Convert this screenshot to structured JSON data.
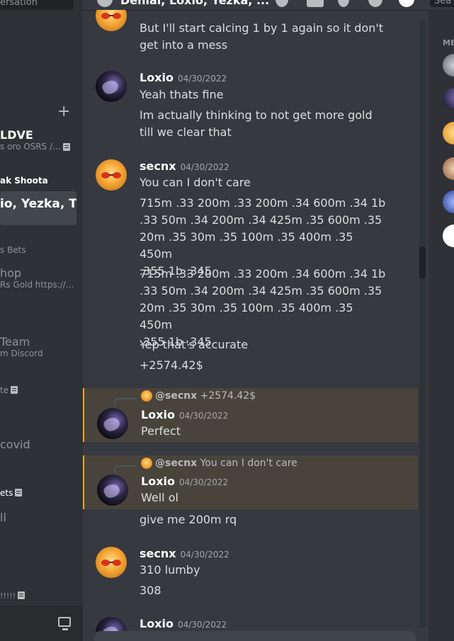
{
  "sidebar": {
    "search_text": "ersation",
    "dms": [
      {
        "name": "LDVE",
        "sub": "s oro OSRS /...",
        "note": true,
        "bold": true
      },
      {
        "name": "ak Shoota",
        "bold": true
      },
      {
        "name": "io, Yezka, T...",
        "bold": true,
        "active": true
      },
      {
        "name": "s Bets"
      },
      {
        "name": "hop",
        "sub": "Rs Gold https://..."
      },
      {
        "name": "Team",
        "sub": "m Discord"
      },
      {
        "name": "te",
        "note": true
      },
      {
        "name": "covid"
      },
      {
        "name": "ets",
        "note": true
      },
      {
        "name": "ll"
      },
      {
        "name": "!!!!!",
        "note": true
      }
    ]
  },
  "header": {
    "title": "Denial, Loxio, Yezka, ...",
    "search_text": "Sea"
  },
  "members": {
    "heading": "ME",
    "icons": [
      "avatar-gray",
      "avatar-dark",
      "avatar-orange",
      "avatar-anime",
      "avatar-blue",
      "avatar-logo"
    ]
  },
  "chat": {
    "continuation": "But I'll start calcing 1 by 1 again so it don't get into a mess",
    "m1": {
      "author": "Loxio",
      "time": "04/30/2022",
      "lines": [
        "Yeah thats fine",
        "Im actually thinking to not get more gold till we clear that"
      ]
    },
    "m2": {
      "author": "secnx",
      "time": "04/30/2022",
      "lines": [
        "You can I don't care",
        "715m  .33 200m .33 200m .34 600m  .34 1b\n.33 50m .34  200m .34  425m .35 600m .35\n20m .35 30m .35 100m .35 400m .35 450m\n.355 1b .345",
        "715m .33 200m .33 200m .34 600m .34 1b\n.33 50m .34  200m .34 425m .35 600m .35\n20m .35  30m .35 100m .35 400m .35  450m\n.355 1b .345",
        "Yep that's accurate",
        "+2574.42$"
      ]
    },
    "m3": {
      "ref_author": "@secnx",
      "ref_text": "+2574.42$",
      "author": "Loxio",
      "time": "04/30/2022",
      "lines": [
        "Perfect"
      ]
    },
    "m4": {
      "ref_author": "@secnx",
      "ref_text": "You can I don't care",
      "author": "Loxio",
      "time": "04/30/2022",
      "lines": [
        "Well ol"
      ]
    },
    "m4b": "give me 200m rq",
    "m5": {
      "author": "secnx",
      "time": "04/30/2022",
      "lines": [
        "310 lumby",
        "308"
      ]
    },
    "m6": {
      "author": "Loxio",
      "time": "04/30/2022"
    }
  }
}
